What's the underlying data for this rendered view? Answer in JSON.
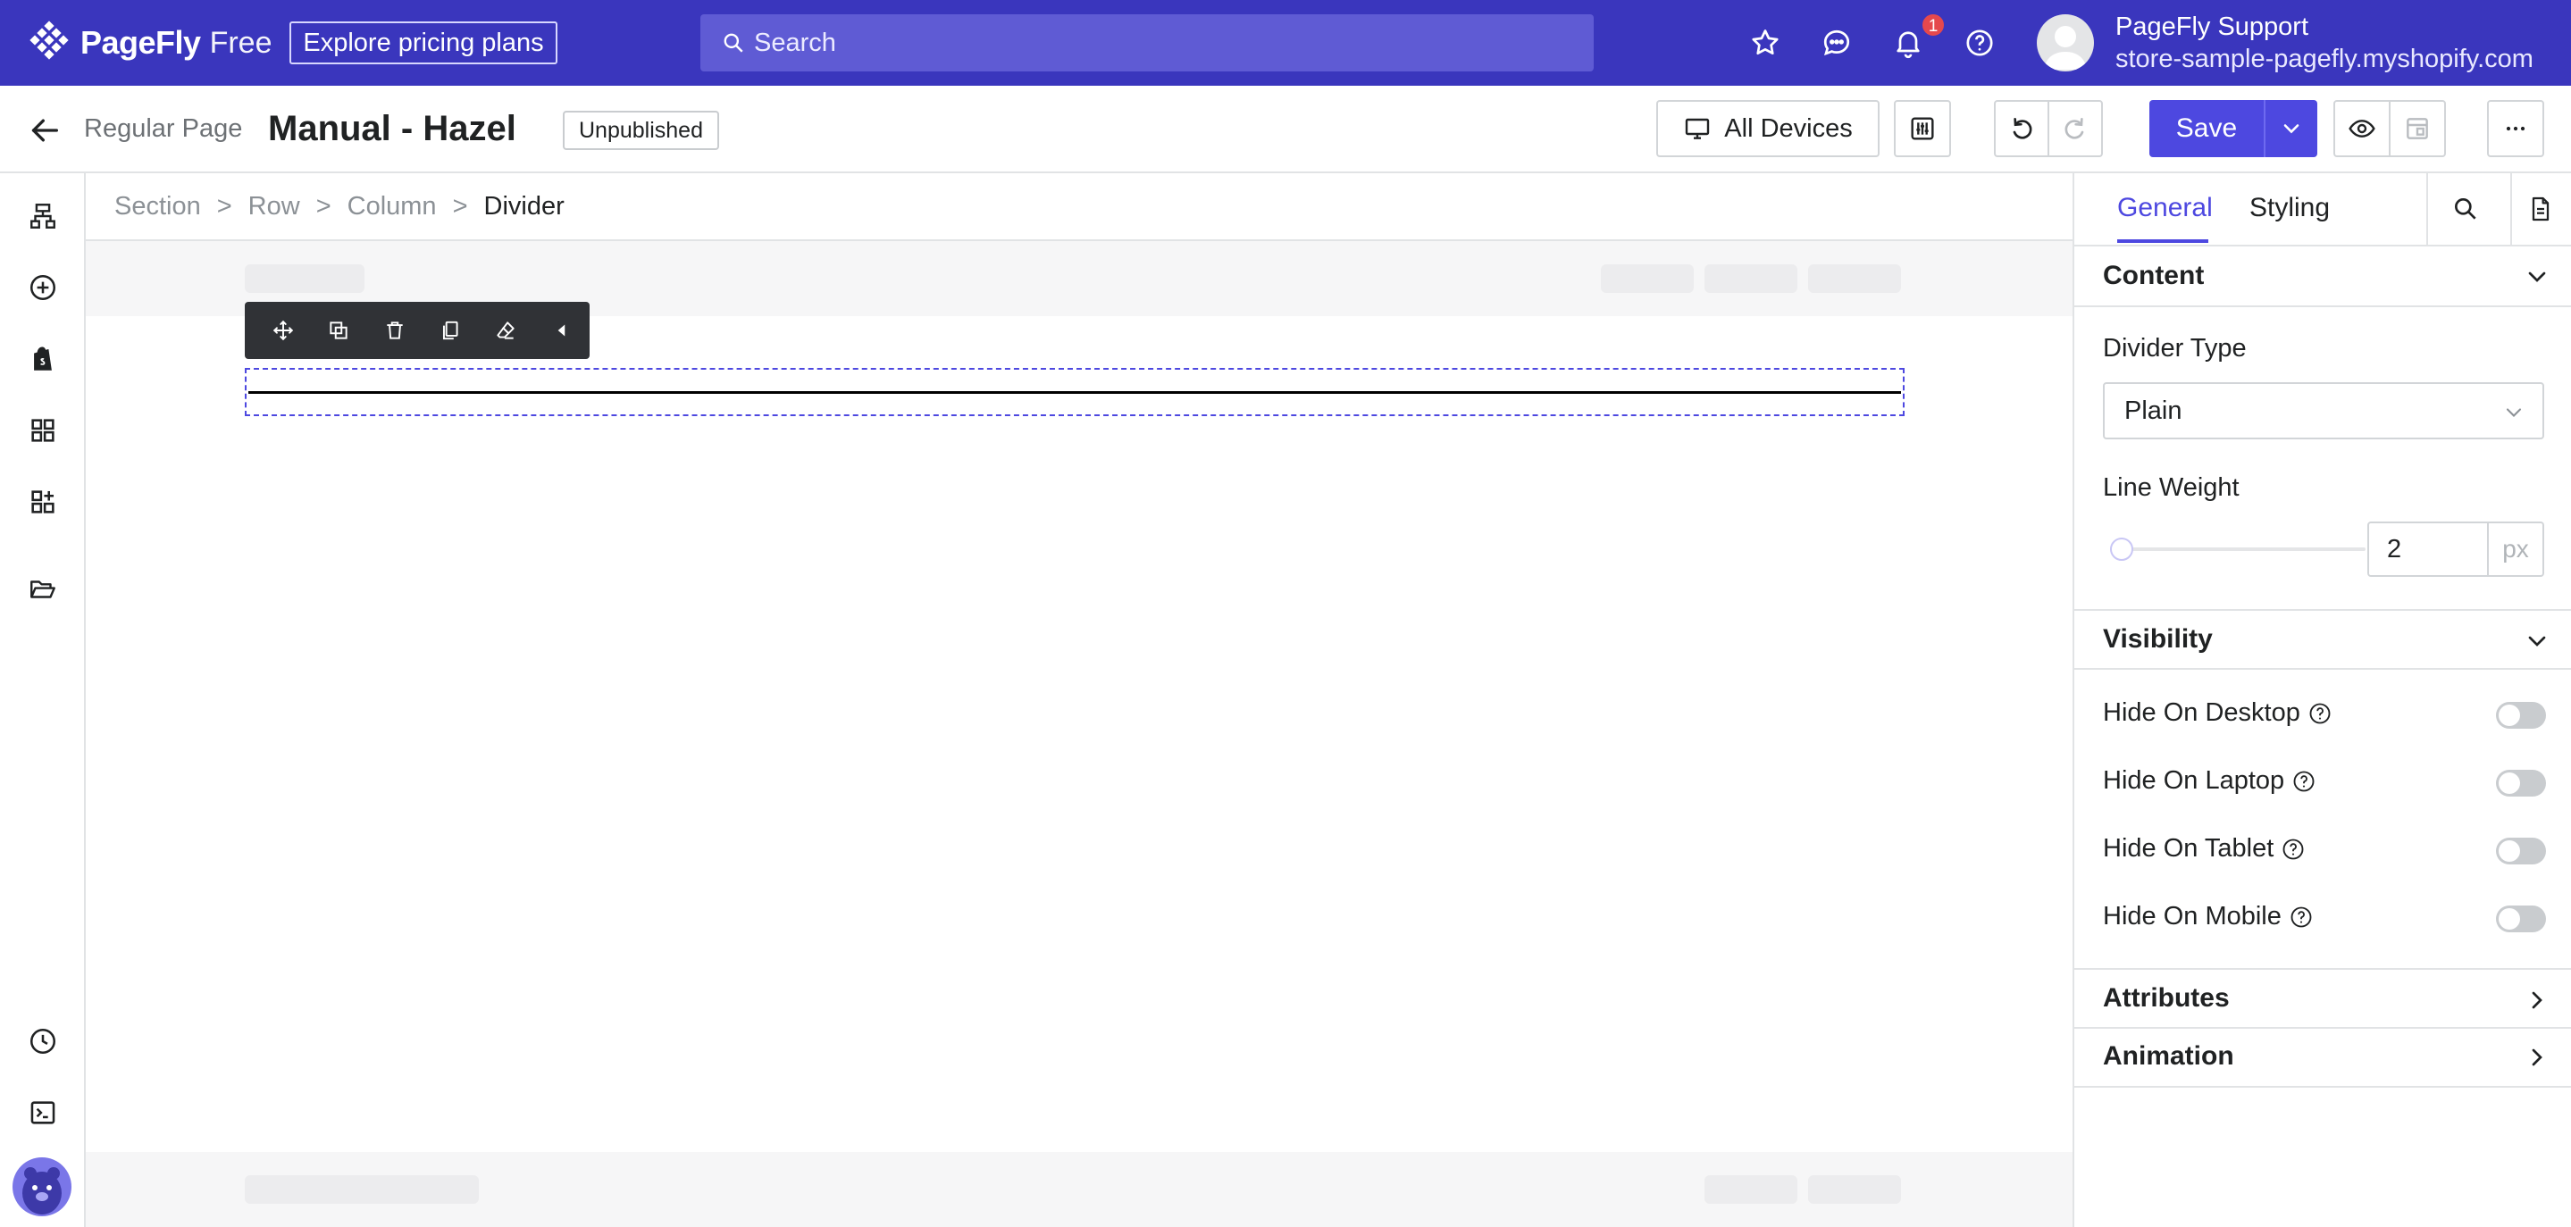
{
  "topbar": {
    "brand": "PageFly",
    "plan": "Free",
    "pricing_label": "Explore pricing plans",
    "search_placeholder": "Search",
    "notification_count": "1",
    "user_name": "PageFly Support",
    "store": "store-sample-pagefly.myshopify.com",
    "icons": [
      "star-icon",
      "chat-icon",
      "bell-icon",
      "help-icon"
    ]
  },
  "toolbar": {
    "page_type": "Regular Page",
    "page_title": "Manual - Hazel",
    "status": "Unpublished",
    "devices_label": "All Devices",
    "save_label": "Save"
  },
  "breadcrumb": {
    "items": [
      "Section",
      "Row",
      "Column",
      "Divider"
    ]
  },
  "panel": {
    "tabs": [
      "General",
      "Styling"
    ],
    "content_heading": "Content",
    "divider_type_label": "Divider Type",
    "divider_type_value": "Plain",
    "line_weight_label": "Line Weight",
    "line_weight_value": "2",
    "line_weight_unit": "px",
    "visibility_heading": "Visibility",
    "visibility_options": [
      {
        "label": "Hide On Desktop",
        "on": false
      },
      {
        "label": "Hide On Laptop",
        "on": false
      },
      {
        "label": "Hide On Tablet",
        "on": false
      },
      {
        "label": "Hide On Mobile",
        "on": false
      }
    ],
    "attributes_heading": "Attributes",
    "animation_heading": "Animation"
  },
  "colors": {
    "brand": "#3a36bd",
    "accent": "#4d48e0",
    "search_bg": "#5f5bd4",
    "badge": "#e5484d"
  }
}
